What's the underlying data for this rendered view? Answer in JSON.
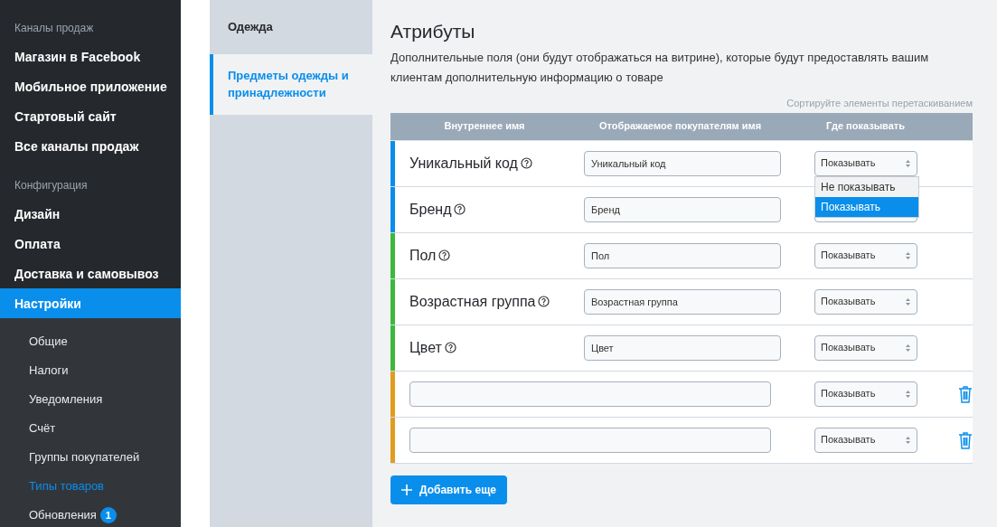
{
  "sidebar": {
    "sections": [
      {
        "heading": "Каналы продаж",
        "items": [
          {
            "label": "Магазин в Facebook",
            "selected": false
          },
          {
            "label": "Мобильное приложение",
            "selected": false
          },
          {
            "label": "Стартовый сайт",
            "selected": false
          },
          {
            "label": "Все каналы продаж",
            "selected": false
          }
        ]
      },
      {
        "heading": "Конфигурация",
        "items": [
          {
            "label": "Дизайн",
            "selected": false
          },
          {
            "label": "Оплата",
            "selected": false
          },
          {
            "label": "Доставка и самовывоз",
            "selected": false
          },
          {
            "label": "Настройки",
            "selected": true,
            "children": [
              {
                "label": "Общие",
                "selected": false
              },
              {
                "label": "Налоги",
                "selected": false
              },
              {
                "label": "Уведомления",
                "selected": false
              },
              {
                "label": "Счёт",
                "selected": false
              },
              {
                "label": "Группы покупателей",
                "selected": false
              },
              {
                "label": "Типы товаров",
                "selected": true
              },
              {
                "label": "Обновления",
                "selected": false,
                "badge": "1"
              }
            ]
          }
        ]
      }
    ]
  },
  "categories": [
    {
      "label": "Одежда",
      "selected": false
    },
    {
      "label": "Предметы одежды и принадлежности",
      "selected": true
    }
  ],
  "main": {
    "title": "Атрибуты",
    "description": "Дополнительные поля (они будут отображаться на витрине), которые будут предоставлять вашим клиентам дополнительную информацию о товаре",
    "sort_hint": "Сортируйте элементы перетаскиванием",
    "columns": [
      "Внутреннее имя",
      "Отображаемое покупателям имя",
      "Где показывать"
    ],
    "rows": [
      {
        "kind": "builtin",
        "color": "#0a8eeb",
        "name": "Уникальный код",
        "display_name": "Уникальный код",
        "where": "Показывать",
        "dropdown": [
          {
            "label": "Не показывать",
            "selected": false
          },
          {
            "label": "Показывать",
            "selected": true
          }
        ]
      },
      {
        "kind": "builtin",
        "color": "#0a8eeb",
        "name": "Бренд",
        "display_name": "Бренд"
      },
      {
        "kind": "builtin",
        "color": "#3cb93c",
        "name": "Пол",
        "display_name": "Пол",
        "where": "Показывать"
      },
      {
        "kind": "builtin",
        "color": "#3cb93c",
        "name": "Возрастная группа",
        "display_name": "Возрастная группа",
        "where": "Показывать"
      },
      {
        "kind": "builtin",
        "color": "#3cb93c",
        "name": "Цвет",
        "display_name": "Цвет",
        "where": "Показывать"
      },
      {
        "kind": "custom",
        "color": "#e29d1e",
        "where": "Показывать"
      },
      {
        "kind": "custom",
        "color": "#e29d1e",
        "where": "Показывать"
      }
    ],
    "add_button": "Добавить еще"
  }
}
